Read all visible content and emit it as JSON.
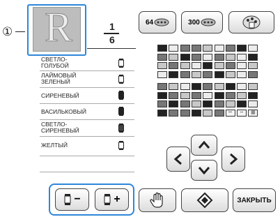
{
  "callout": {
    "number": "①"
  },
  "preview": {
    "letter": "R"
  },
  "counter": {
    "current": "1",
    "total": "6"
  },
  "top_buttons": {
    "count_64": "64",
    "count_300": "300"
  },
  "color_list": [
    {
      "name": "СВЕТЛО-ГОЛУБОЙ"
    },
    {
      "name": "ЛАЙМОВЫЙ ЗЕЛЕНЫЙ"
    },
    {
      "name": "СИРЕНЕВЫЙ"
    },
    {
      "name": "ВАСИЛЬКОВЫЙ"
    },
    {
      "name": "СВЕТЛО-СИРЕНЕВЫЙ"
    },
    {
      "name": "ЖЕЛТЫЙ"
    }
  ],
  "spool_buttons": {
    "minus": "−",
    "plus": "+"
  },
  "bottom_buttons": {
    "close": "ЗАКРЫТЬ"
  },
  "icons": [
    "spool-icon",
    "spool-64-icon",
    "spool-300-icon",
    "thread-palette-icon",
    "arrow-up-icon",
    "arrow-down-icon",
    "arrow-left-icon",
    "arrow-right-icon",
    "hand-icon",
    "jump-icon",
    "scissors-icon",
    "dashed-line-icon",
    "grid-icon"
  ],
  "colors": {
    "highlight_border": "#2e86d8",
    "palette_dark": "#222222",
    "palette_mid": "#777777",
    "palette_light": "#c8c8c8",
    "palette_pale": "#ececec"
  }
}
